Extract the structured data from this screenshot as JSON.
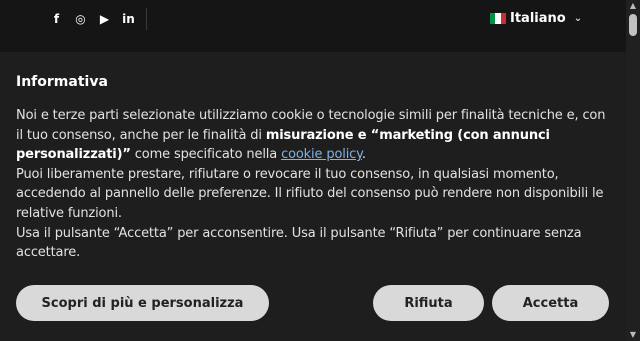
{
  "topbar": {
    "social": [
      {
        "name": "facebook",
        "glyph": "f"
      },
      {
        "name": "instagram",
        "glyph": "◎"
      },
      {
        "name": "youtube",
        "glyph": "▶"
      },
      {
        "name": "linkedin",
        "glyph": "in"
      }
    ],
    "language": "Italiano",
    "flag_colors": [
      "#009246",
      "#ffffff",
      "#ce2b37"
    ]
  },
  "notice": {
    "title": "Informativa",
    "p1_a": "Noi e terze parti selezionate utilizziamo cookie o tecnologie simili per finalità tecniche e, con il tuo consenso, anche per le finalità di ",
    "p1_bold": "misurazione e “marketing (con annunci personalizzati)”",
    "p1_b": " come specificato nella ",
    "p1_link": "cookie policy",
    "p1_c": ".",
    "p2": "Puoi liberamente prestare, rifiutare o revocare il tuo consenso, in qualsiasi momento, accedendo al pannello delle preferenze. Il rifiuto del consenso può rendere non disponibili le relative funzioni.",
    "p3": "Usa il pulsante “Accetta” per acconsentire. Usa il pulsante “Rifiuta” per continuare senza accettare."
  },
  "buttons": {
    "personalize": "Scopri di più e personalizza",
    "reject": "Rifiuta",
    "accept": "Accetta"
  }
}
